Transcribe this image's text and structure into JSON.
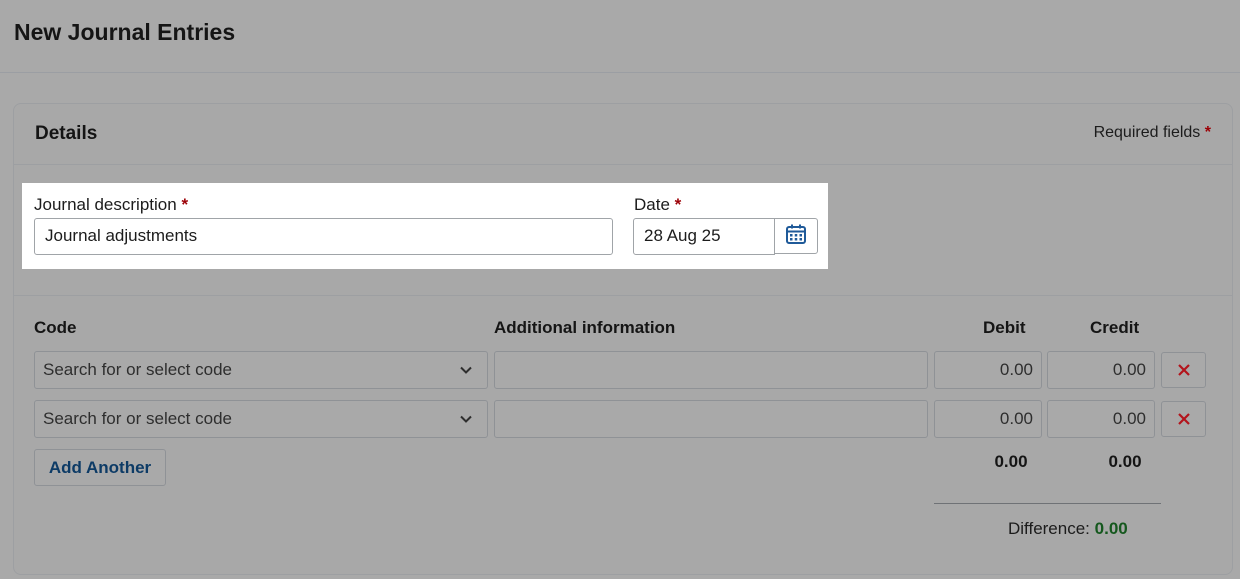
{
  "page": {
    "title": "New Journal Entries"
  },
  "details": {
    "title": "Details",
    "required_note": "Required fields",
    "required_star": "*"
  },
  "form": {
    "description_label": "Journal description",
    "description_value": "Journal adjustments",
    "date_label": "Date",
    "date_value": "28 Aug 25",
    "required_star": "*"
  },
  "table": {
    "headers": {
      "code": "Code",
      "info": "Additional information",
      "debit": "Debit",
      "credit": "Credit"
    },
    "rows": [
      {
        "code_placeholder": "Search for or select code",
        "info": "",
        "debit": "0.00",
        "credit": "0.00"
      },
      {
        "code_placeholder": "Search for or select code",
        "info": "",
        "debit": "0.00",
        "credit": "0.00"
      }
    ],
    "add_label": "Add Another",
    "total_debit": "0.00",
    "total_credit": "0.00",
    "difference_label": "Difference:",
    "difference_value": "0.00"
  },
  "colors": {
    "required_star": "#9c0006",
    "difference_value": "#15581e",
    "add_button_text": "#0d3b66",
    "delete_icon": "#b3141c",
    "calendar_icon": "#1f5a99"
  },
  "icons": {
    "calendar": "calendar-icon",
    "chevron": "chevron-down-icon",
    "delete": "close-icon"
  }
}
